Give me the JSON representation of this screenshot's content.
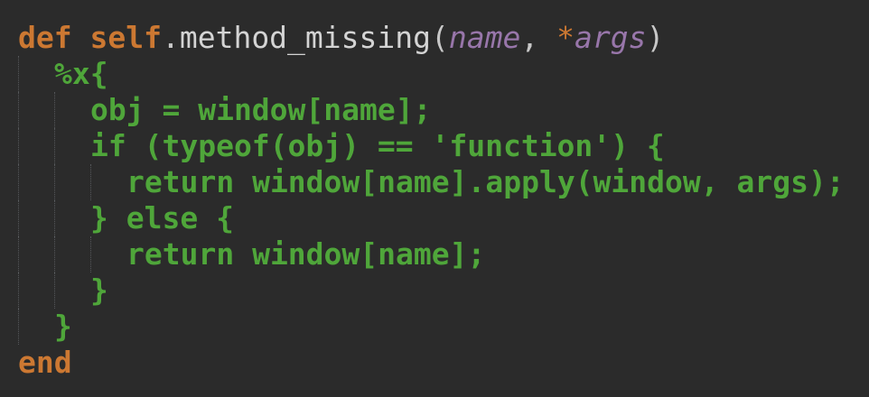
{
  "colors": {
    "background": "#2b2b2b",
    "keyword": "#cc7832",
    "embedded_js": "#4fa63a",
    "parameter": "#9876aa",
    "plain": "#c8c8c8"
  },
  "code": {
    "line1": {
      "def": "def",
      "self": "self",
      "dot": ".",
      "method": "method_missing",
      "open_paren": "(",
      "param_name": "name",
      "comma": ",",
      "splat": "*",
      "param_args": "args",
      "close_paren": ")"
    },
    "line2": "%x{",
    "line3": "obj = window[name];",
    "line4": "if (typeof(obj) == 'function') {",
    "line5": "return window[name].apply(window, args);",
    "line6": "} else {",
    "line7": "return window[name];",
    "line8": "}",
    "line9": "}",
    "line10": "end"
  }
}
